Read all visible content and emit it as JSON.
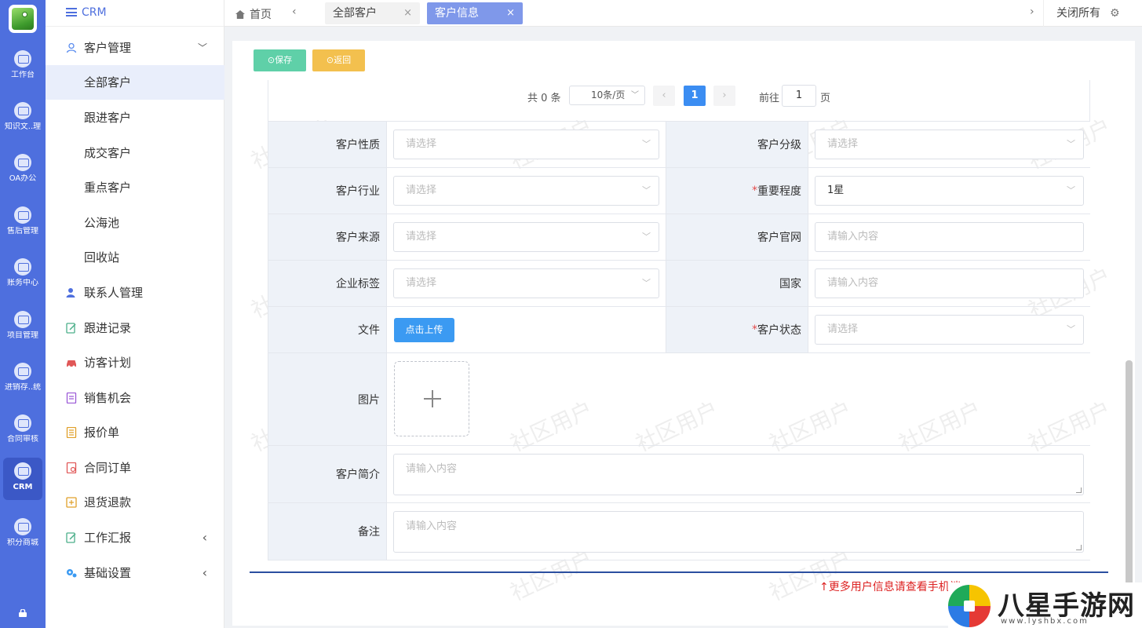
{
  "colors": {
    "rail": "#4e6fde",
    "accent": "#3b8df2",
    "save": "#5fd0a8",
    "back": "#f3c04e",
    "active_tab": "#7f98ea"
  },
  "rail": {
    "items": [
      {
        "label": "工作台",
        "icon": "monitor-icon"
      },
      {
        "label": "知识文..理",
        "icon": "monitor-icon"
      },
      {
        "label": "OA办公",
        "icon": "monitor-icon"
      },
      {
        "label": "售后管理",
        "icon": "monitor-icon"
      },
      {
        "label": "账务中心",
        "icon": "monitor-icon"
      },
      {
        "label": "项目管理",
        "icon": "monitor-icon"
      },
      {
        "label": "进销存..统",
        "icon": "monitor-icon"
      },
      {
        "label": "合同审核",
        "icon": "monitor-icon"
      },
      {
        "label": "CRM",
        "icon": "monitor-icon"
      },
      {
        "label": "积分商城",
        "icon": "monitor-icon"
      }
    ]
  },
  "menu": {
    "title": "CRM",
    "items": [
      {
        "label": "客户管理",
        "icon": "users-icon",
        "arrow": "﹀"
      },
      {
        "label": "全部客户"
      },
      {
        "label": "跟进客户"
      },
      {
        "label": "成交客户"
      },
      {
        "label": "重点客户"
      },
      {
        "label": "公海池"
      },
      {
        "label": "回收站"
      },
      {
        "label": "联系人管理",
        "icon": "contact-icon"
      },
      {
        "label": "跟进记录",
        "icon": "edit-icon"
      },
      {
        "label": "访客计划",
        "icon": "car-icon"
      },
      {
        "label": "销售机会",
        "icon": "document-icon"
      },
      {
        "label": "报价单",
        "icon": "list-icon"
      },
      {
        "label": "合同订单",
        "icon": "contract-icon"
      },
      {
        "label": "退货退款",
        "icon": "refund-icon"
      },
      {
        "label": "工作汇报",
        "icon": "report-icon",
        "arrow": "‹"
      },
      {
        "label": "基础设置",
        "icon": "settings-icon",
        "arrow": "‹"
      }
    ]
  },
  "tabs": {
    "home": "首页",
    "items": [
      {
        "label": "全部客户",
        "close": "×"
      },
      {
        "label": "客户信息",
        "close": "×"
      }
    ],
    "close_all": "关闭所有"
  },
  "toolbar": {
    "save": "⊙保存",
    "back": "⊙返回"
  },
  "pager": {
    "total": "共 0 条",
    "page_size": "10条/页",
    "current": "1",
    "goto_label": "前往",
    "goto_value": "1",
    "page_unit": "页"
  },
  "form": {
    "rows": [
      {
        "left_label": "客户性质",
        "left_value": "请选择",
        "right_label": "客户分级",
        "right_value": "请选择"
      },
      {
        "left_label": "客户行业",
        "left_value": "请选择",
        "right_label": "重要程度",
        "right_required": "*",
        "right_value": "1星"
      },
      {
        "left_label": "客户来源",
        "left_value": "请选择",
        "right_label": "客户官网",
        "right_value": "请输入内容"
      },
      {
        "left_label": "企业标签",
        "left_value": "请选择",
        "right_label": "国家",
        "right_value": "请输入内容"
      },
      {
        "left_label": "文件",
        "upload": "点击上传",
        "right_label": "客户状态",
        "right_required": "*",
        "right_value": "请选择"
      }
    ],
    "picture_label": "图片",
    "intro_label": "客户简介",
    "intro_placeholder": "请输入内容",
    "remark_label": "备注",
    "remark_placeholder": "请输入内容"
  },
  "watermark": "社区用户",
  "footer_note": "↑更多用户信息请查看手机端",
  "brand": {
    "name": "八星手游网",
    "url": "www.lyshbx.com"
  }
}
